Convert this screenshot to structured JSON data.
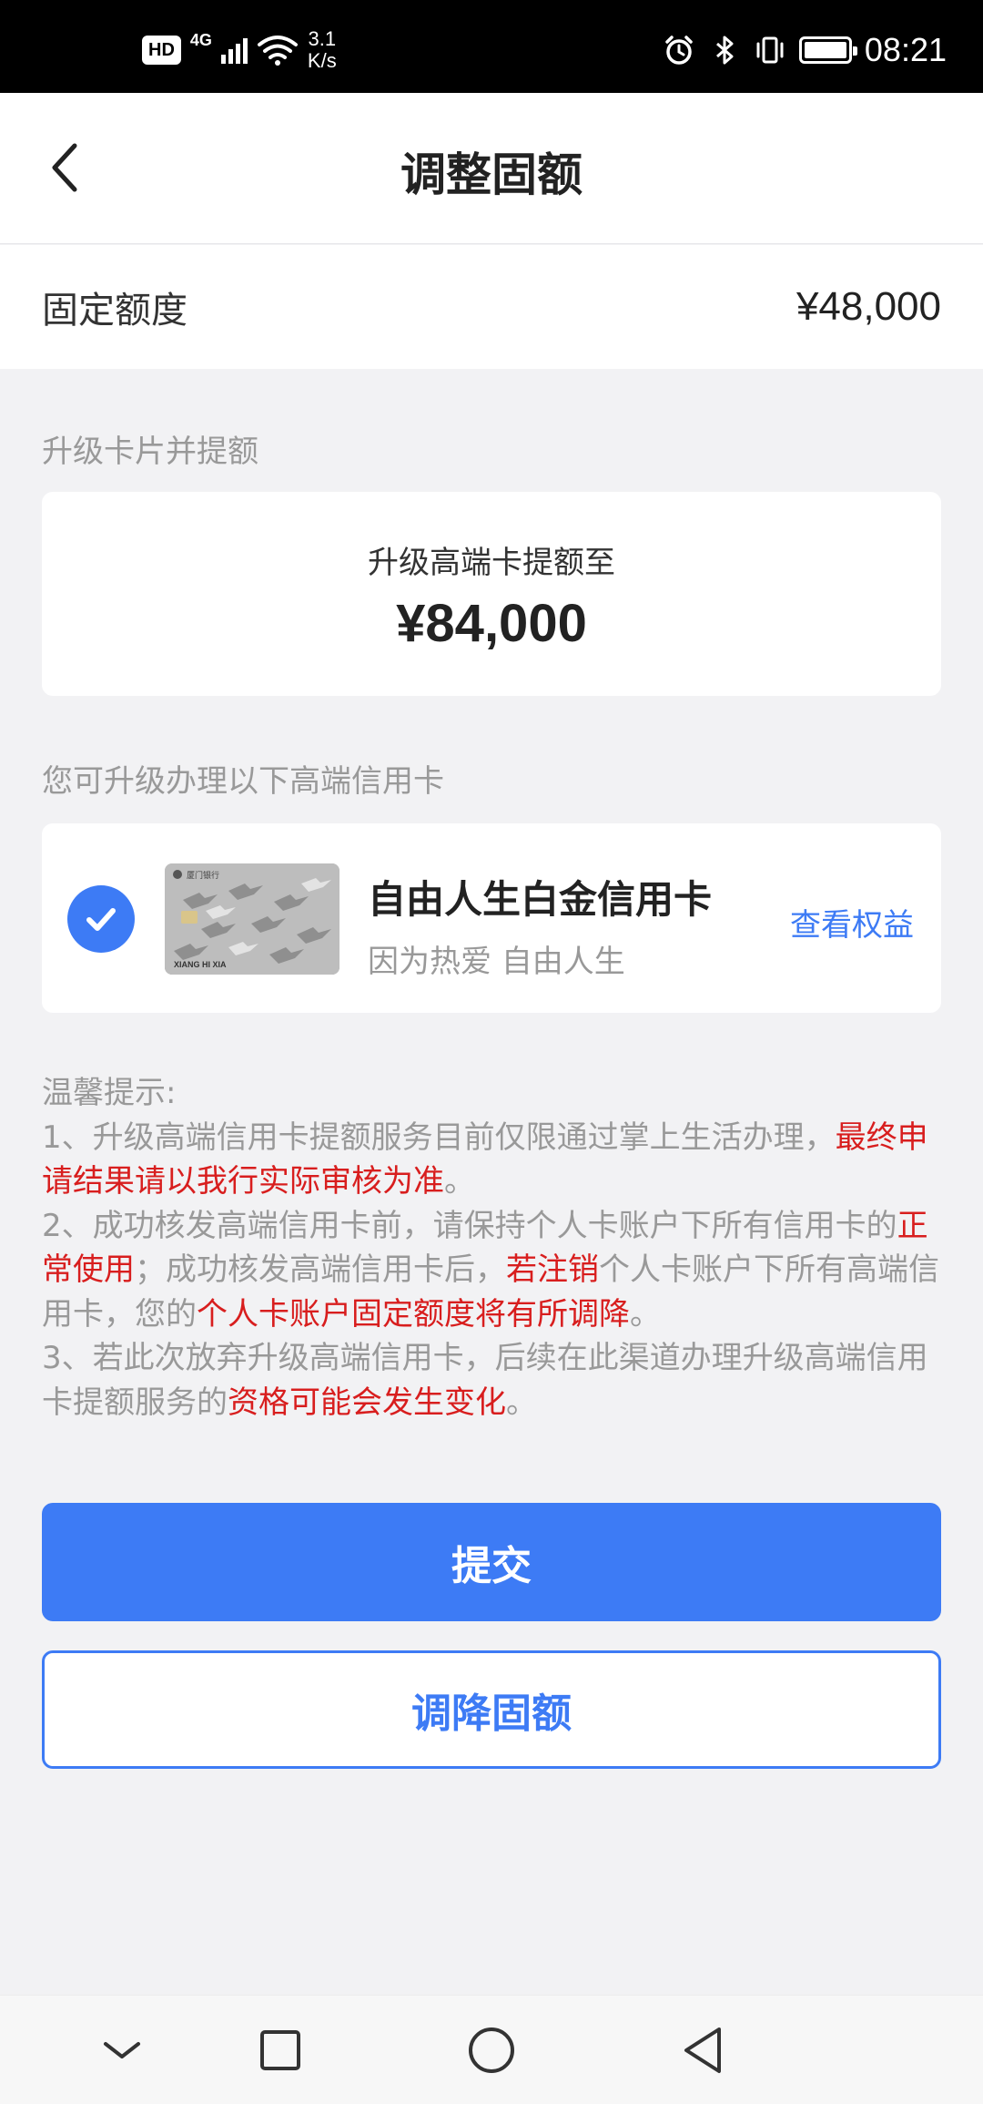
{
  "status_bar": {
    "hd": "HD",
    "network": "4G",
    "speed_value": "3.1",
    "speed_unit": "K/s",
    "time": "08:21",
    "icons": [
      "alarm-icon",
      "bluetooth-icon",
      "vibrate-icon",
      "battery-icon"
    ]
  },
  "header": {
    "title": "调整固额",
    "back_icon": "chevron-left-icon"
  },
  "fixed_limit": {
    "label": "固定额度",
    "value": "¥48,000"
  },
  "upgrade_section": {
    "label": "升级卡片并提额",
    "card_subtitle": "升级高端卡提额至",
    "amount": "¥84,000"
  },
  "card_section": {
    "label": "您可升级办理以下高端信用卡",
    "selected": true,
    "card_name": "自由人生白金信用卡",
    "card_slogan": "因为热爱 自由人生",
    "view_benefits": "查看权益",
    "card_image_brand": "厦门银行",
    "card_image_holder": "XIANG HI XIA"
  },
  "notes": {
    "heading": "温馨提示:",
    "n1_a": "1、升级高端信用卡提额服务目前仅限通过掌上生活办理，",
    "n1_red": "最终申请结果请以我行实际审核为准",
    "n1_b": "。",
    "n2_a": "2、成功核发高端信用卡前，请保持个人卡账户下所有信用卡的",
    "n2_red1": "正常使用",
    "n2_b": "；成功核发高端信用卡后，",
    "n2_red2": "若注销",
    "n2_c": "个人卡账户下所有高端信用卡，您的",
    "n2_red3": "个人卡账户固定额度将有所调降",
    "n2_d": "。",
    "n3_a": "3、若此次放弃升级高端信用卡，后续在此渠道办理升级高端信用卡提额服务的",
    "n3_red": "资格可能会发生变化",
    "n3_b": "。"
  },
  "buttons": {
    "submit": "提交",
    "decrease": "调降固额"
  },
  "nav_bar": {
    "icons": [
      "nav-down-icon",
      "nav-recents-icon",
      "nav-home-icon",
      "nav-back-icon"
    ]
  },
  "colors": {
    "accent": "#3d7bf5",
    "warning_red": "#d81e1e",
    "muted_text": "#999999",
    "background": "#f2f2f4"
  }
}
